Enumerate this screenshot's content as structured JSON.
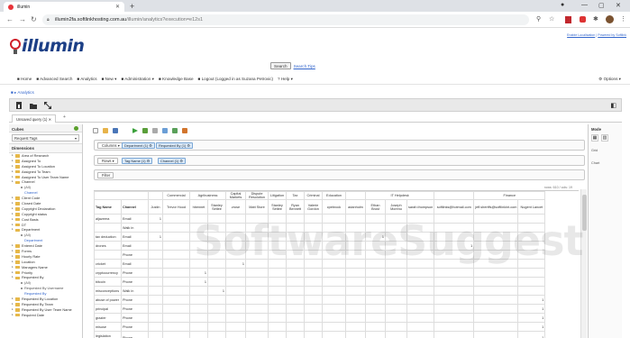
{
  "browser": {
    "tab_title": "illumin",
    "url_host": "illumin2fa.softlinkhosting.com.au",
    "url_path": "/illumin/analytics?execution=e12s1"
  },
  "header": {
    "links": [
      "Enable Localisation",
      "Powered by Softlink"
    ],
    "logo_text": "illumin",
    "search_button": "Search",
    "search_tips": "Search Tips"
  },
  "menu": {
    "items": [
      "Home",
      "Advanced Search",
      "Analytics",
      "New",
      "Administration",
      "Knowledge Base",
      "Logout (Logged in as Suzana Petrovic)",
      "Help"
    ],
    "options": "Options"
  },
  "breadcrumb": "Analytics",
  "query_tab": "Unsaved query (1)",
  "left": {
    "cubes_title": "Cubes",
    "cube_selected": "Request Tags",
    "dimensions_title": "Dimensions",
    "dimensions": [
      {
        "label": "Area of Research",
        "level": 0
      },
      {
        "label": "Assigned To",
        "level": 0
      },
      {
        "label": "Assigned To Location",
        "level": 0
      },
      {
        "label": "Assigned To Team",
        "level": 0
      },
      {
        "label": "Assigned To User Team Name",
        "level": 0
      },
      {
        "label": "Channel",
        "level": 0
      },
      {
        "label": "(All)",
        "level": 1
      },
      {
        "label": "Channel",
        "level": 2
      },
      {
        "label": "Client Code",
        "level": 0
      },
      {
        "label": "Closed Date",
        "level": 0
      },
      {
        "label": "Copyright Declaration",
        "level": 0
      },
      {
        "label": "Copyright status",
        "level": 0
      },
      {
        "label": "Cost Basis",
        "level": 0
      },
      {
        "label": "DT",
        "level": 0
      },
      {
        "label": "Department",
        "level": 0
      },
      {
        "label": "(All)",
        "level": 1
      },
      {
        "label": "Department",
        "level": 2
      },
      {
        "label": "Entered Date",
        "level": 0
      },
      {
        "label": "Forms",
        "level": 0
      },
      {
        "label": "Hourly Rate",
        "level": 0
      },
      {
        "label": "Location",
        "level": 0
      },
      {
        "label": "Managers Name",
        "level": 0
      },
      {
        "label": "Priority",
        "level": 0
      },
      {
        "label": "Requested By",
        "level": 0
      },
      {
        "label": "(All)",
        "level": 1
      },
      {
        "label": "Requested By Username",
        "level": 1
      },
      {
        "label": "Requested By",
        "level": 2
      },
      {
        "label": "Requested By Location",
        "level": 0
      },
      {
        "label": "Requested By Team",
        "level": 0
      },
      {
        "label": "Requested By User Team Name",
        "level": 0
      },
      {
        "label": "Required Date",
        "level": 0
      }
    ]
  },
  "query": {
    "columns_label": "Columns",
    "columns_chips": [
      "Department (1)",
      "Requested By (1)"
    ],
    "rows_label": "Rows",
    "rows_chips": [
      "Tag Name (1)",
      "Channel (1)"
    ],
    "filter_label": "Filter",
    "size_info": "rows: 610 / cols: 19"
  },
  "grid": {
    "dept_headers": [
      {
        "label": "",
        "span": 1
      },
      {
        "label": "Commercial",
        "span": 1
      },
      {
        "label": "Agribusiness",
        "span": 2
      },
      {
        "label": "Capital Markets",
        "span": 1
      },
      {
        "label": "Dispute Resolution",
        "span": 1
      },
      {
        "label": "Litigation",
        "span": 1
      },
      {
        "label": "Tax",
        "span": 1
      },
      {
        "label": "Criminal",
        "span": 1
      },
      {
        "label": "Education",
        "span": 1
      },
      {
        "label": "",
        "span": 1
      },
      {
        "label": "IT Helpdesk",
        "span": 3
      },
      {
        "label": "",
        "span": 1
      },
      {
        "label": "Finance",
        "span": 2
      }
    ],
    "row_header_tag": "Tag Name",
    "row_header_channel": "Channel",
    "person_headers": [
      "Justin",
      "Trevor Hood",
      "hbennet",
      "Stanley Setlee",
      "zrose",
      "Matt Store",
      "Stanley Setlee",
      "Ryan Bennett",
      "Valerie Gordon",
      "cpebrock",
      "adanholm",
      "Ethan Brust",
      "Joseph Moreno",
      "sarah.thompson",
      "softlinks@hotmail.com",
      "jeff.sheriffs@softlinkint.com",
      "Nugent Lancet"
    ],
    "rows": [
      {
        "tag": "aljazeera",
        "channel": "Email",
        "vals": [
          "1",
          "",
          "",
          "",
          "",
          "",
          "",
          "",
          "",
          "",
          "",
          "",
          "",
          "",
          "",
          "",
          ""
        ]
      },
      {
        "tag": "",
        "channel": "Walk in",
        "vals": [
          "",
          "",
          "",
          "",
          "",
          "",
          "",
          "",
          "",
          "",
          "",
          "",
          "",
          "",
          "",
          "",
          ""
        ]
      },
      {
        "tag": "tax deduction",
        "channel": "Email",
        "vals": [
          "1",
          "",
          "",
          "",
          "",
          "",
          "",
          "",
          "",
          "",
          "",
          "1",
          "",
          "",
          "",
          "",
          ""
        ]
      },
      {
        "tag": "drones",
        "channel": "Email",
        "vals": [
          "",
          "",
          "",
          "",
          "",
          "",
          "",
          "",
          "",
          "",
          "",
          "",
          "",
          "",
          "1",
          "",
          ""
        ]
      },
      {
        "tag": "",
        "channel": "Phone",
        "vals": [
          "",
          "",
          "",
          "",
          "",
          "",
          "",
          "",
          "",
          "",
          "",
          "",
          "",
          "",
          "",
          "",
          ""
        ]
      },
      {
        "tag": "cricket",
        "channel": "Email",
        "vals": [
          "",
          "",
          "",
          "",
          "1",
          "",
          "",
          "",
          "",
          "",
          "",
          "",
          "",
          "",
          "",
          "",
          ""
        ]
      },
      {
        "tag": "cryptocurrency",
        "channel": "Phone",
        "vals": [
          "",
          "",
          "1",
          "",
          "",
          "",
          "",
          "",
          "",
          "",
          "",
          "",
          "",
          "",
          "",
          "",
          ""
        ]
      },
      {
        "tag": "bitcoin",
        "channel": "Phone",
        "vals": [
          "",
          "",
          "1",
          "",
          "",
          "",
          "",
          "",
          "",
          "",
          "",
          "",
          "",
          "",
          "",
          "",
          ""
        ]
      },
      {
        "tag": "misconceptions",
        "channel": "Walk in",
        "vals": [
          "",
          "",
          "",
          "1",
          "",
          "",
          "",
          "",
          "",
          "",
          "",
          "",
          "",
          "",
          "",
          "",
          ""
        ]
      },
      {
        "tag": "abuse of power",
        "channel": "Phone",
        "vals": [
          "",
          "",
          "",
          "",
          "",
          "",
          "",
          "",
          "",
          "",
          "",
          "",
          "",
          "",
          "",
          "",
          "1"
        ]
      },
      {
        "tag": "principal",
        "channel": "Phone",
        "vals": [
          "",
          "",
          "",
          "",
          "",
          "",
          "",
          "",
          "",
          "",
          "",
          "",
          "",
          "",
          "",
          "",
          "1"
        ]
      },
      {
        "tag": "grazier",
        "channel": "Phone",
        "vals": [
          "",
          "",
          "",
          "",
          "",
          "",
          "",
          "",
          "",
          "",
          "",
          "",
          "",
          "",
          "",
          "",
          "1"
        ]
      },
      {
        "tag": "misuse",
        "channel": "Phone",
        "vals": [
          "",
          "",
          "",
          "",
          "",
          "",
          "",
          "",
          "",
          "",
          "",
          "",
          "",
          "",
          "",
          "",
          "1"
        ]
      },
      {
        "tag": "legislation against",
        "channel": "Phone",
        "vals": [
          "",
          "",
          "",
          "",
          "",
          "",
          "",
          "",
          "",
          "",
          "",
          "",
          "",
          "",
          "",
          "",
          "1"
        ]
      }
    ]
  },
  "right": {
    "mode_title": "Mode",
    "sub1": "Grid",
    "sub2": "Chart"
  },
  "watermark": "SoftwareSuggest",
  "colors": {
    "logo_blue": "#1c3f86",
    "logo_red": "#d0202a",
    "link": "#3366cc",
    "chip_bg": "#dbe9f7"
  }
}
